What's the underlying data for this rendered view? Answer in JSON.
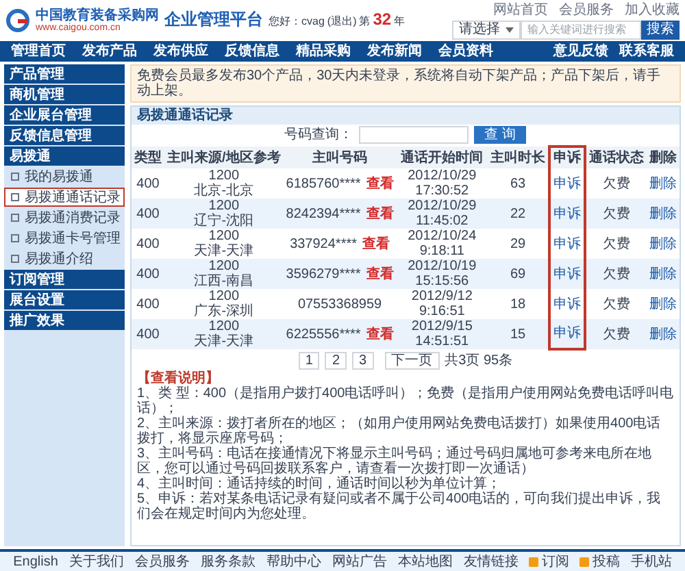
{
  "header": {
    "logo_title": "中国教育装备采购网",
    "logo_url": "www.caigou.com.cn",
    "platform_title": "企业管理平台",
    "greeting": "您好：cvag",
    "logout": "(退出)",
    "years_prefix": "第",
    "years": "32",
    "years_suffix": "年",
    "top_links": [
      "网站首页",
      "会员服务",
      "加入收藏"
    ],
    "search": {
      "category": "请选择",
      "placeholder": "输入关键词进行搜索",
      "button": "搜索"
    }
  },
  "nav": {
    "left": [
      "管理首页",
      "发布产品",
      "发布供应",
      "反馈信息",
      "精品采购",
      "发布新闻",
      "会员资料"
    ],
    "right": [
      "意见反馈",
      "联系客服"
    ]
  },
  "sidebar": [
    {
      "label": "产品管理",
      "kind": "header"
    },
    {
      "label": "商机管理",
      "kind": "header"
    },
    {
      "label": "企业展台管理",
      "kind": "header"
    },
    {
      "label": "反馈信息管理",
      "kind": "header"
    },
    {
      "label": "易拨通",
      "kind": "header"
    },
    {
      "label": "我的易拨通",
      "kind": "sub",
      "selected": false
    },
    {
      "label": "易拨通通话记录",
      "kind": "sub",
      "selected": true
    },
    {
      "label": "易拨通消费记录",
      "kind": "sub",
      "selected": false
    },
    {
      "label": "易拨通卡号管理",
      "kind": "sub",
      "selected": false
    },
    {
      "label": "易拨通介绍",
      "kind": "sub",
      "selected": false
    },
    {
      "label": "订阅管理",
      "kind": "header"
    },
    {
      "label": "展台设置",
      "kind": "header"
    },
    {
      "label": "推广效果",
      "kind": "header"
    }
  ],
  "notice": "免费会员最多发布30个产品，30天内未登录，系统将自动下架产品；产品下架后，请手动上架。",
  "panel": {
    "title": "易拨通通话记录",
    "search_label": "号码查询：",
    "search_button": "查 询",
    "columns": [
      {
        "label": "类型",
        "highlighted": false
      },
      {
        "label": "主叫来源/地区参考",
        "highlighted": false
      },
      {
        "label": "主叫号码",
        "highlighted": false
      },
      {
        "label": "通话开始时间",
        "highlighted": false
      },
      {
        "label": "主叫时长",
        "highlighted": false
      },
      {
        "label": "申诉",
        "highlighted": true
      },
      {
        "label": "通话状态",
        "highlighted": false
      },
      {
        "label": "删除",
        "highlighted": false
      }
    ],
    "rows": [
      {
        "type": "400",
        "source_code": "1200",
        "source_region": "北京-北京",
        "number": "6185760****",
        "view": "查看",
        "start_time": "2012/10/29 17:30:52",
        "duration": "63",
        "appeal": "申诉",
        "status": "欠费",
        "delete": "删除"
      },
      {
        "type": "400",
        "source_code": "1200",
        "source_region": "辽宁-沈阳",
        "number": "8242394****",
        "view": "查看",
        "start_time": "2012/10/29 11:45:02",
        "duration": "22",
        "appeal": "申诉",
        "status": "欠费",
        "delete": "删除"
      },
      {
        "type": "400",
        "source_code": "1200",
        "source_region": "天津-天津",
        "number": "337924****",
        "view": "查看",
        "start_time": "2012/10/24 9:18:11",
        "duration": "29",
        "appeal": "申诉",
        "status": "欠费",
        "delete": "删除"
      },
      {
        "type": "400",
        "source_code": "1200",
        "source_region": "江西-南昌",
        "number": "3596279****",
        "view": "查看",
        "start_time": "2012/10/19 15:15:56",
        "duration": "69",
        "appeal": "申诉",
        "status": "欠费",
        "delete": "删除"
      },
      {
        "type": "400",
        "source_code": "1200",
        "source_region": "广东-深圳",
        "number": "07553368959",
        "start_time": "2012/9/12 9:16:51",
        "duration": "18",
        "appeal": "申诉",
        "status": "欠费",
        "delete": "删除"
      },
      {
        "type": "400",
        "source_code": "1200",
        "source_region": "天津-天津",
        "number": "6225556****",
        "view": "查看",
        "start_time": "2012/9/15 14:51:51",
        "duration": "15",
        "appeal": "申诉",
        "status": "欠费",
        "delete": "删除"
      }
    ],
    "pagination": {
      "pages": [
        "1",
        "2",
        "3"
      ],
      "next": "下一页",
      "summary": "共3页 95条"
    },
    "notes_title": "【查看说明】",
    "notes": [
      "1、类 型：400（是指用户拨打400电话呼叫）；免费（是指用户使用网站免费电话呼叫电话）；",
      "2、主叫来源：拨打者所在的地区；（如用户使用网站免费电话拨打）如果使用400电话拨打，将显示座席号码；",
      "3、主叫号码：电话在接通情况下将显示主叫号码；通过号码归属地可参考来电所在地区，您可以通过号码回拨联系客户，请查看一次拨打即一次通话）",
      "4、主叫时间：通话持续的时间，通话时间以秒为单位计算；",
      "5、申诉：若对某条电话记录有疑问或者不属于公司400电话的，可向我们提出申诉，我们会在规定时间内为您处理。"
    ]
  },
  "footer": [
    {
      "label": "English",
      "kind": "plain"
    },
    {
      "label": "关于我们",
      "kind": "plain"
    },
    {
      "label": "会员服务",
      "kind": "plain"
    },
    {
      "label": "服务条款",
      "kind": "plain"
    },
    {
      "label": "帮助中心",
      "kind": "plain"
    },
    {
      "label": "网站广告",
      "kind": "plain"
    },
    {
      "label": "本站地图",
      "kind": "plain"
    },
    {
      "label": "友情链接",
      "kind": "plain"
    },
    {
      "label": "订阅",
      "kind": "feed"
    },
    {
      "label": "投稿",
      "kind": "feed"
    },
    {
      "label": "手机站",
      "kind": "plain"
    }
  ]
}
